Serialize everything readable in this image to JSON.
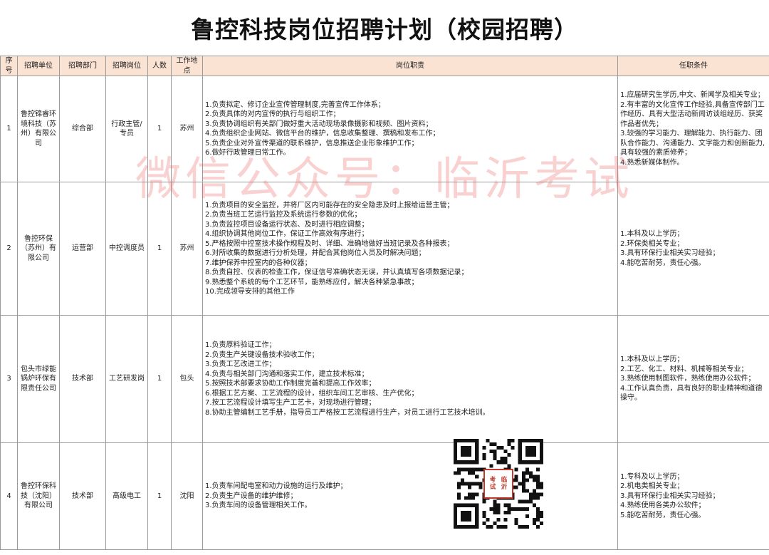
{
  "title": "鲁控科技岗位招聘计划（校园招聘）",
  "headers": [
    "序号",
    "招聘单位",
    "招聘部门",
    "招聘岗位",
    "人数",
    "工作地点",
    "岗位职责",
    "任职条件"
  ],
  "rows": [
    {
      "no": "1",
      "unit": "鲁控锦睿环境科技（苏州）有限公司",
      "dept": "综合部",
      "position": "行政主管/专员",
      "count": "1",
      "location": "苏州",
      "duties": [
        "1.负责拟定、修订企业宣传管理制度,完善宣传工作体系；",
        "2.负责具体的对内宣传的执行与组织工作；",
        "3.负责协调组织有关部门做好重大活动现场录像摄影和视频、图片资料；",
        "4.负责组织企业网站、微信平台的维护，信息收集整理、撰稿和发布工作；",
        "5.负责企业对外宣传渠道的联系维护，信息推送企业形象维护工作；",
        "6.做好行政管理日常工作。"
      ],
      "requirements": [
        "1.应届研究生学历,中文、新闻学及相关专业；",
        "2.有丰富的文化宣传工作经验,具备宣传部门工作经历、具有大型活动新闻访谈组经历、获奖作品者优先；",
        "3.较强的学习能力、理解能力、执行能力、团队合作能力、沟通能力、文字能力和创新能力,具有较强的素质修养；",
        "4.熟悉新媒体制作。"
      ]
    },
    {
      "no": "2",
      "unit": "鲁控环保（苏州）有限公司",
      "dept": "运营部",
      "position": "中控调度员",
      "count": "1",
      "location": "苏州",
      "duties": [
        "1.负责项目的安全监控，并将厂区内可能存在的安全隐患及时上报给运营主管；",
        "2.负责当班工艺运行监控及系统运行参数的优化；",
        "3.负责监控项目设备运行状态、及时进行相应调整；",
        "4.组织协调其他岗位工作，保证工作高效有序进行；",
        "5.严格按照中控室技术操作规程及时、详细、准确地做好当班记录及各种报表；",
        "6.对所收集的数据进行分析处理，并配合其他岗位人员及时解决问题；",
        "7.维护保养中控室内的各种仪器；",
        "8.负责自控、仪表的检查工作，保证信号准确状态无误，并认真填写各项数据记录；",
        "9.熟悉整个系统的每个工艺环节，能熟练应付，解决各种紧急事故；",
        "10.完成领导安排的其他工作"
      ],
      "requirements": [
        "1.本科及以上学历；",
        "2.环保类相关专业；",
        "3.具有环保行业相关实习经验；",
        "4.能吃苦耐劳，责任心强。"
      ]
    },
    {
      "no": "3",
      "unit": "包头市绿能锅炉环保有限责任公司",
      "dept": "技术部",
      "position": "工艺研发岗",
      "count": "1",
      "location": "包头",
      "duties": [
        "1.负责原料验证工作；",
        "2.负责生产关键设备技术验收工作；",
        "3.负责工艺改进工作；",
        "4.负责与相关部门沟通和落实工作，建立技术标准；",
        "5.按照技术部要求协助工作制度完善和提高工作效率；",
        "6.根据工艺方案、工艺流程的设计，组织车间工艺审核、生产优化；",
        "7.按工艺流程设计填写生产工艺卡，对现场进行管理；",
        "8.协助主管编制工艺手册，指导员工严格按工艺流程进行生产，对员工进行工艺技术培训。"
      ],
      "requirements": [
        "1.本科及以上学历；",
        "2.工艺、化工、材料、机械等相关专业；",
        "3.熟练使用制图软件，熟练使用办公软件；",
        "4.工作认真负责，具有良好的职业精神和道德操守。"
      ]
    },
    {
      "no": "4",
      "unit": "鲁控环保科技（沈阳）有限公司",
      "dept": "技术部",
      "position": "高级电工",
      "count": "1",
      "location": "沈阳",
      "duties": [
        "1.负责车间配电室和动力设施的运行及维护；",
        "2.负责生产设备的维护维修；",
        "3.负责车间的设备管理相关工作。"
      ],
      "requirements": [
        "1.专科及以上学历；",
        "2.机电类相关专业；",
        "3.具有环保行业相关实习经验；",
        "4.熟练使用各类办公软件；",
        "5.能吃苦耐劳，责任心强。"
      ]
    }
  ],
  "watermark": "微信公众号：临沂考试",
  "qr_seal": [
    "考",
    "临",
    "试",
    "沂"
  ],
  "colors": {
    "header_bg": "#fbe3d4",
    "watermark": "#e85a5a",
    "seal": "#c0392b"
  }
}
